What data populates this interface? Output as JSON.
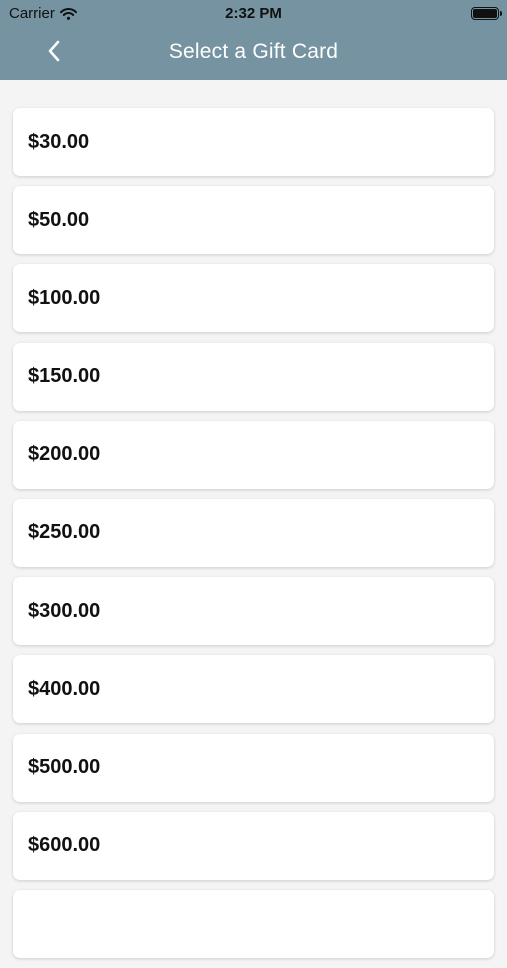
{
  "status_bar": {
    "carrier": "Carrier",
    "time": "2:32 PM"
  },
  "nav": {
    "title": "Select a Gift Card",
    "back_icon": "chevron-left-icon"
  },
  "colors": {
    "header_background": "#7593a0",
    "page_background": "#f4f4f4",
    "card_background": "#ffffff"
  },
  "gift_cards": [
    {
      "amount": "$30.00"
    },
    {
      "amount": "$50.00"
    },
    {
      "amount": "$100.00"
    },
    {
      "amount": "$150.00"
    },
    {
      "amount": "$200.00"
    },
    {
      "amount": "$250.00"
    },
    {
      "amount": "$300.00"
    },
    {
      "amount": "$400.00"
    },
    {
      "amount": "$500.00"
    },
    {
      "amount": "$600.00"
    },
    {
      "amount": ""
    }
  ]
}
